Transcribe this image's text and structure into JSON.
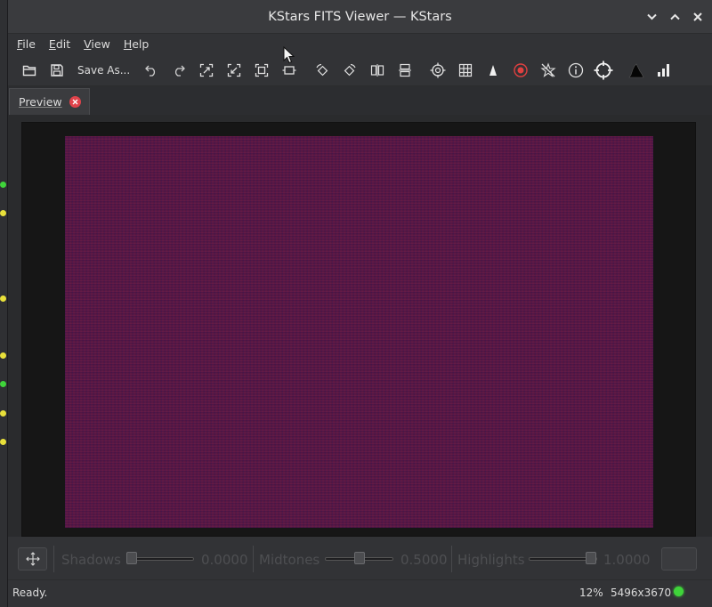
{
  "window": {
    "title": "KStars FITS Viewer — KStars"
  },
  "menubar": {
    "items": [
      {
        "prefix": "",
        "underline": "F",
        "rest": "ile"
      },
      {
        "prefix": "",
        "underline": "E",
        "rest": "dit"
      },
      {
        "prefix": "",
        "underline": "V",
        "rest": "iew"
      },
      {
        "prefix": "",
        "underline": "H",
        "rest": "elp"
      }
    ]
  },
  "toolbar": {
    "save_as_label": "Save As...",
    "icons": [
      "open-icon",
      "save-icon",
      "undo-icon",
      "redo-icon",
      "zoom-in-icon",
      "zoom-out-icon",
      "zoom-fit-icon",
      "zoom-default-icon",
      "rotate-ccw-icon",
      "rotate-cw-icon",
      "flip-horizontal-icon",
      "flip-vertical-icon",
      "crosshair-icon",
      "grid-icon",
      "pixel-grid-icon",
      "mark-stars-icon",
      "hide-stars-icon",
      "info-icon",
      "target-icon",
      "histogram-icon",
      "statistics-icon"
    ]
  },
  "tabs": {
    "active_label": "Preview"
  },
  "stretch": {
    "shadows_label": "Shadows",
    "shadows_value": "0.0000",
    "shadows_level": 0.0,
    "midtones_label": "Midtones",
    "midtones_value": "0.5000",
    "midtones_level": 0.5,
    "highlights_label": "Highlights",
    "highlights_value": "1.0000",
    "highlights_level": 1.0
  },
  "status": {
    "message": "Ready.",
    "zoom": "12%",
    "resolution": "5496x3670",
    "led_color": "#3fd43a"
  },
  "colors": {
    "image_tint": "#5a1a44",
    "close_tab": "#e0434b"
  }
}
